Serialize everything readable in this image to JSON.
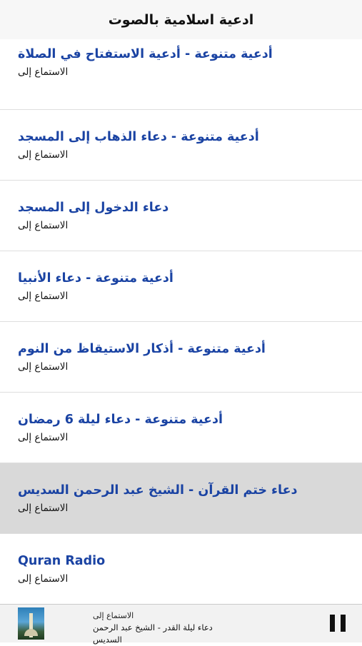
{
  "header": {
    "title": "ادعية اسلامية بالصوت"
  },
  "list": {
    "items": [
      {
        "title": "أدعية متنوعة - أدعية الاستفتاح في الصلاة",
        "subtitle": "الاستماع إلى",
        "selected": false
      },
      {
        "title": "أدعية متنوعة - دعاء الذهاب إلى المسجد",
        "subtitle": "الاستماع إلى",
        "selected": false
      },
      {
        "title": "دعاء الدخول إلى المسجد",
        "subtitle": "الاستماع إلى",
        "selected": false
      },
      {
        "title": "أدعية متنوعة - دعاء الأنبيا",
        "subtitle": "الاستماع إلى",
        "selected": false
      },
      {
        "title": "أدعية متنوعة - أذكار الاستيقاظ من النوم",
        "subtitle": "الاستماع إلى",
        "selected": false
      },
      {
        "title": "أدعية متنوعة - دعاء ليلة 6 رمضان",
        "subtitle": "الاستماع إلى",
        "selected": false
      },
      {
        "title": "دعاء ختم القرآن - الشيخ عبد الرحمن السديس",
        "subtitle": "الاستماع إلى",
        "selected": true
      },
      {
        "title": "Quran Radio",
        "subtitle": "الاستماع إلى",
        "selected": false
      }
    ]
  },
  "player": {
    "subtitle": "الاستماع إلى",
    "title": "دعاء ليلة القدر - الشيخ عبد الرحمن السديس",
    "artwork_icon": "mosque-artwork",
    "control_icon": "pause-icon"
  },
  "colors": {
    "accent": "#1a43a3",
    "selected_row": "#d9d9d9",
    "nav_bg": "#f7f7f7"
  }
}
